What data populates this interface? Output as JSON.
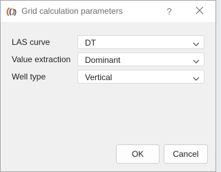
{
  "window": {
    "title": "Grid calculation parameters",
    "app_icon": "app-logo-icon",
    "help_label": "?",
    "close_icon": "close-icon"
  },
  "form": {
    "las_curve": {
      "label": "LAS curve",
      "value": "DT"
    },
    "value_extraction": {
      "label": "Value extraction",
      "value": "Dominant"
    },
    "well_type": {
      "label": "Well type",
      "value": "Vertical"
    }
  },
  "buttons": {
    "ok_label": "OK",
    "cancel_label": "Cancel"
  },
  "colors": {
    "window_bg": "#f0f0f0",
    "titlebar_bg": "#ffffff",
    "logo_orange": "#e8731c",
    "logo_blue": "#2c6fb7"
  }
}
